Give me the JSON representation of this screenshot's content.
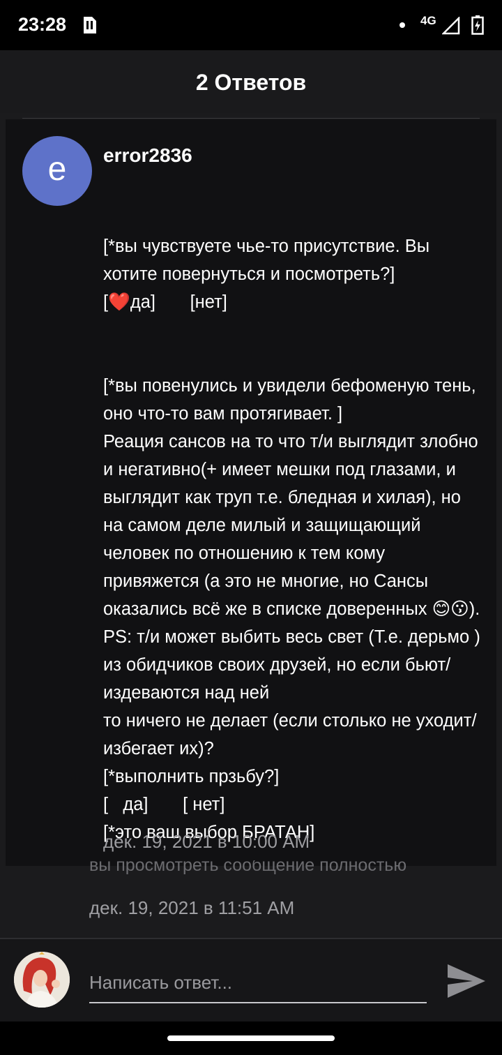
{
  "status_bar": {
    "time": "23:28",
    "network": "4G",
    "icons": [
      "sim-icon",
      "dot-icon",
      "signal-icon",
      "battery-charging-icon"
    ]
  },
  "header": {
    "title": "2 Ответов"
  },
  "comment": {
    "avatar_letter": "e",
    "avatar_color": "#5e72c9",
    "author": "error2836",
    "lines": [
      "[*вы чувствуете чье-то присутствие. Вы хотите повернуться и посмотреть?]",
      "[❤️да]       [нет]",
      "",
      "",
      "[*вы повенулись и увидели бефоменую тень, оно что-то вам протягивает. ]",
      "Реация сансов на то что т/и выглядит злобно и негативно(+ имеет мешки под глазами, и выглядит как труп т.е. бледная и хилая), но на самом деле милый и защищающий человек по отношению к тем кому привяжется (а это не многие, но Сансы оказались всё же в списке доверенных 😊😗).",
      "PS: т/и может выбить весь свет (Т.е. дерьмо ) из обидчиков своих друзей, но если бьют/издеваются над ней",
      "то ничего не делает (если столько не уходит/избегает их)?",
      "[*выполнить прзьбу?]",
      "[   да]       [ нет]",
      "[*это ваш выбор БРАТАН]"
    ],
    "timestamp": "дек. 19, 2021 в 10:00 AM"
  },
  "reply": {
    "preview": "вы просмотреть сообщение полностью",
    "timestamp": "дек. 19, 2021 в 11:51 AM"
  },
  "reply_bar": {
    "placeholder": "Написать ответ...",
    "accent": "#c8c8cc"
  }
}
